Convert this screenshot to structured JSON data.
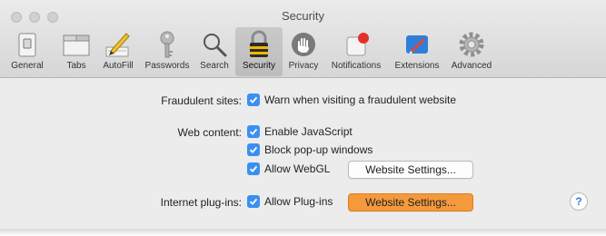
{
  "window": {
    "title": "Security"
  },
  "toolbar": {
    "items": [
      {
        "label": "General",
        "icon": "general-switch-icon"
      },
      {
        "label": "Tabs",
        "icon": "tabs-icon"
      },
      {
        "label": "AutoFill",
        "icon": "autofill-pencil-icon"
      },
      {
        "label": "Passwords",
        "icon": "key-icon"
      },
      {
        "label": "Search",
        "icon": "magnifier-icon"
      },
      {
        "label": "Security",
        "icon": "lock-icon"
      },
      {
        "label": "Privacy",
        "icon": "hand-icon"
      },
      {
        "label": "Notifications",
        "icon": "notification-icon"
      },
      {
        "label": "Extensions",
        "icon": "extensions-icon"
      },
      {
        "label": "Advanced",
        "icon": "gear-icon"
      }
    ],
    "selected": "Security"
  },
  "fraudulent": {
    "label": "Fraudulent sites:",
    "warn": "Warn when visiting a fraudulent website"
  },
  "web_content": {
    "label": "Web content:",
    "javascript": "Enable JavaScript",
    "popups": "Block pop-up windows",
    "webgl": "Allow WebGL",
    "webgl_button": "Website Settings..."
  },
  "plugins": {
    "label": "Internet plug-ins:",
    "allow": "Allow Plug-ins",
    "button": "Website Settings..."
  },
  "help": {
    "label": "?"
  },
  "colors": {
    "accent": "#3b8ff2",
    "highlight": "#f49a3c"
  }
}
